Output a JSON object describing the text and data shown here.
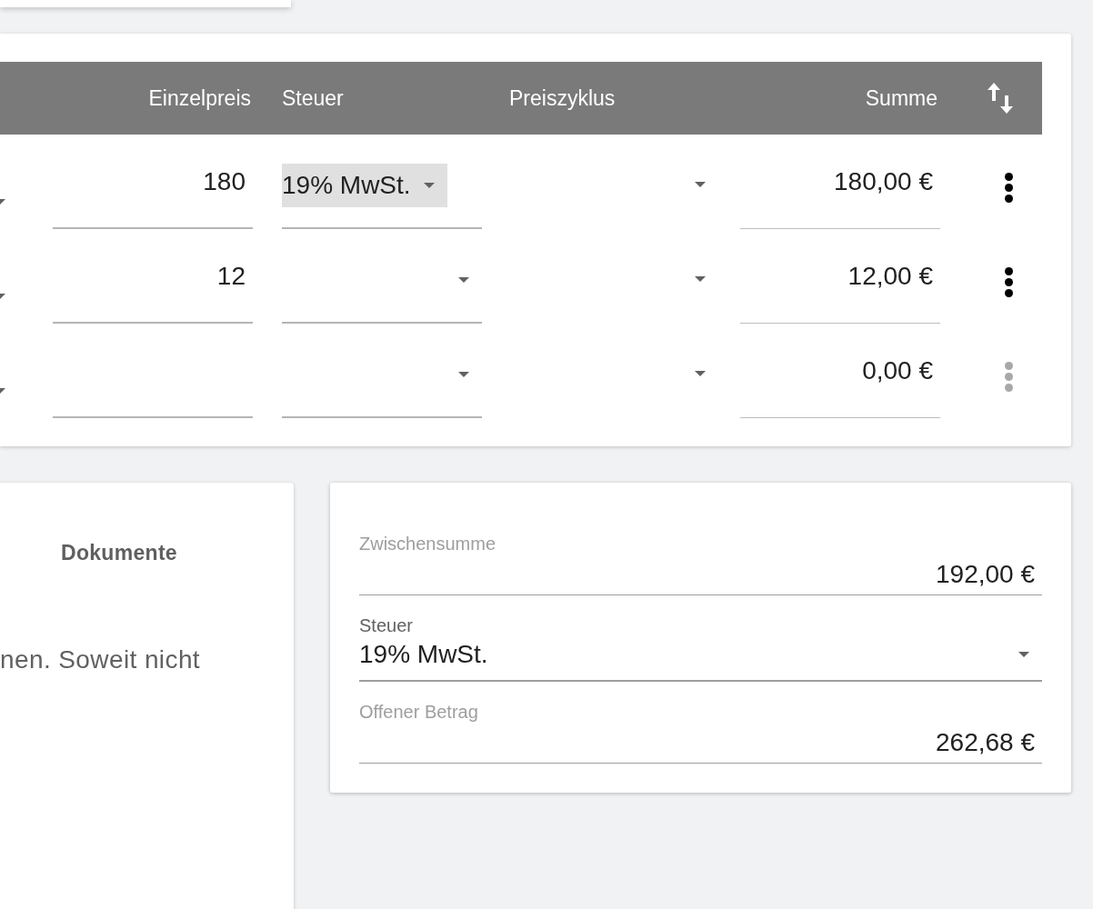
{
  "items_table": {
    "columns": [
      {
        "label": "Einzelpreis"
      },
      {
        "label": "Steuer"
      },
      {
        "label": "Preiszyklus"
      },
      {
        "label": "Summe"
      }
    ],
    "rows": [
      {
        "unit_price": "180",
        "tax": "19% MwSt.",
        "tax_highlighted": true,
        "total": "180,00 €",
        "menu_disabled": false
      },
      {
        "unit_price": "12",
        "tax_highlighted": false,
        "total": "12,00 €",
        "menu_disabled": false
      },
      {
        "tax_highlighted": false,
        "total": "0,00 €",
        "menu_disabled": true
      }
    ]
  },
  "notes_card": {
    "tabs": [
      {
        "label": "Dokumente"
      }
    ],
    "text": "nen. Soweit nicht"
  },
  "summary": {
    "subtotal": {
      "label": "Zwischensumme",
      "value": "192,00 €"
    },
    "tax": {
      "label": "Steuer",
      "value": "19% MwSt."
    },
    "open_amount": {
      "label": "Offener Betrag",
      "value": "262,68 €"
    }
  }
}
